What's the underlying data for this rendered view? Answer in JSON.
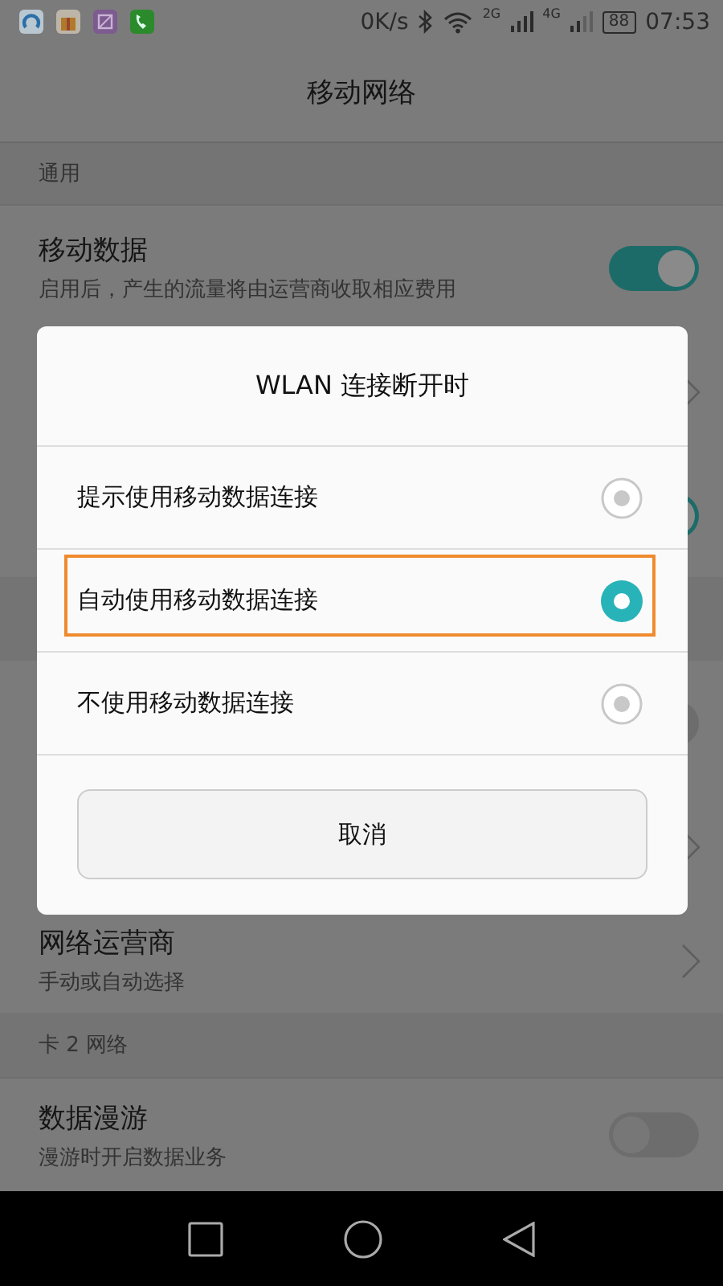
{
  "status_bar": {
    "speed": "0K/s",
    "network_1": "2G",
    "network_2": "4G",
    "battery": "88",
    "time": "07:53"
  },
  "title": "移动网络",
  "sections": [
    {
      "header": "通用",
      "rows": [
        {
          "kind": "toggle",
          "title": "移动数据",
          "subtitle": "启用后，产生的流量将由运营商收取相应费用",
          "on": true
        }
      ]
    },
    {
      "kind": "covered",
      "rows": [
        {
          "kind": "chevron"
        },
        {
          "kind": "toggle",
          "on": true
        },
        {
          "kind": "band"
        },
        {
          "kind": "toggle",
          "on": false
        },
        {
          "kind": "chevron"
        }
      ]
    },
    {
      "rows": [
        {
          "kind": "chevron",
          "title": "网络运营商",
          "subtitle": "手动或自动选择"
        }
      ]
    },
    {
      "header": "卡 2 网络",
      "rows": [
        {
          "kind": "toggle",
          "title": "数据漫游",
          "subtitle": "漫游时开启数据业务",
          "on": false
        }
      ]
    }
  ],
  "dialog": {
    "title": "WLAN 连接断开时",
    "options": [
      {
        "label": "提示使用移动数据连接",
        "selected": false,
        "highlighted": false
      },
      {
        "label": "自动使用移动数据连接",
        "selected": true,
        "highlighted": true
      },
      {
        "label": "不使用移动数据连接",
        "selected": false,
        "highlighted": false
      }
    ],
    "cancel": "取消"
  }
}
